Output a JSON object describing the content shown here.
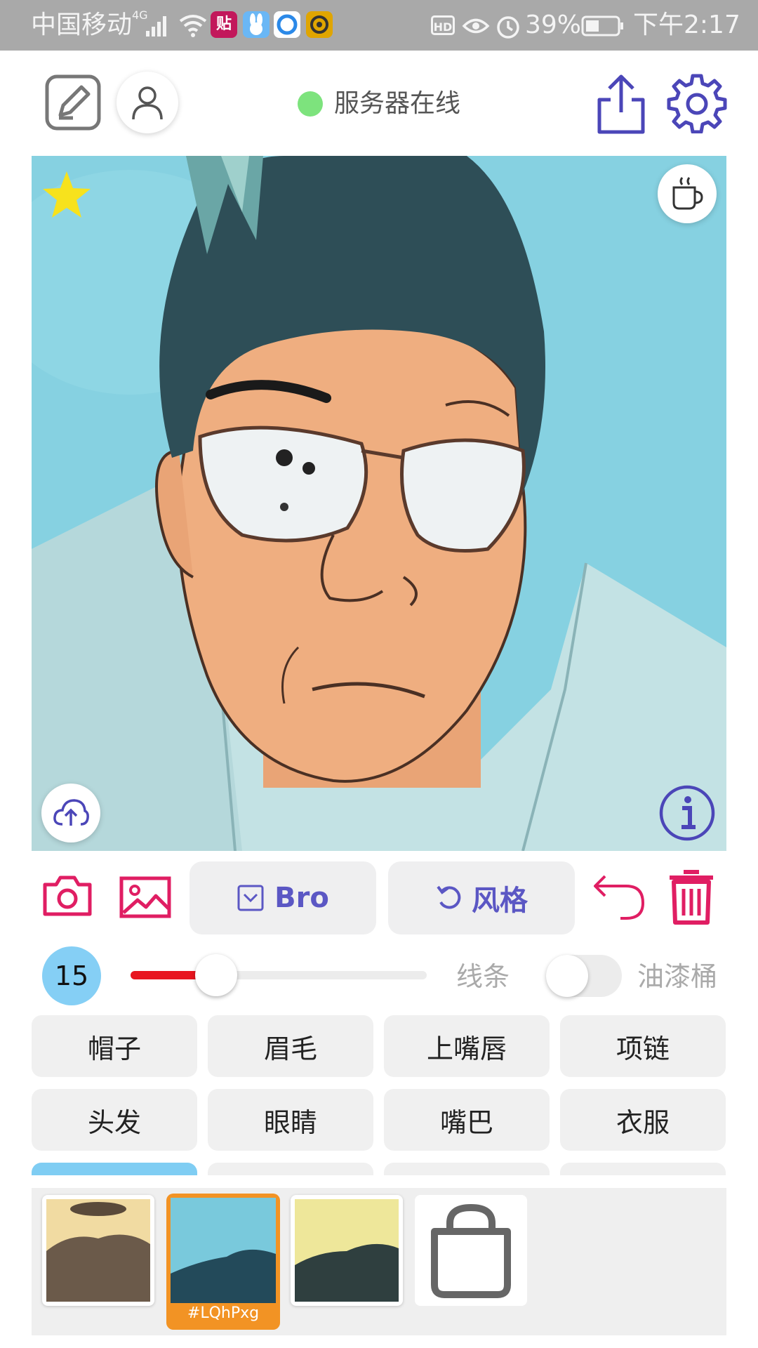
{
  "status_bar": {
    "carrier": "中国移动",
    "network": "4G",
    "battery": "39%",
    "time": "下午2:17",
    "hd": "HD",
    "app_icon_tie": "贴"
  },
  "header": {
    "server_status": "服务器在线",
    "status_color": "#7de37d",
    "accent": "#4b46b8"
  },
  "toolbar": {
    "model_label": "Bro",
    "style_label": "风格",
    "accent_pink": "#e01e63"
  },
  "brush": {
    "size": "15",
    "slider_level": 0.29,
    "line_label": "线条",
    "bucket_label": "油漆桶",
    "bucket_enabled": false
  },
  "parts": [
    "帽子",
    "眉毛",
    "上嘴唇",
    "项链",
    "头发",
    "眼睛",
    "嘴巴",
    "衣服"
  ],
  "thumbnails": [
    {
      "selected": false,
      "bg": "#f1dba2"
    },
    {
      "selected": true,
      "label": "#LQhPxg",
      "bg": "#79c9dc"
    },
    {
      "selected": false,
      "bg": "#eee79a"
    }
  ]
}
